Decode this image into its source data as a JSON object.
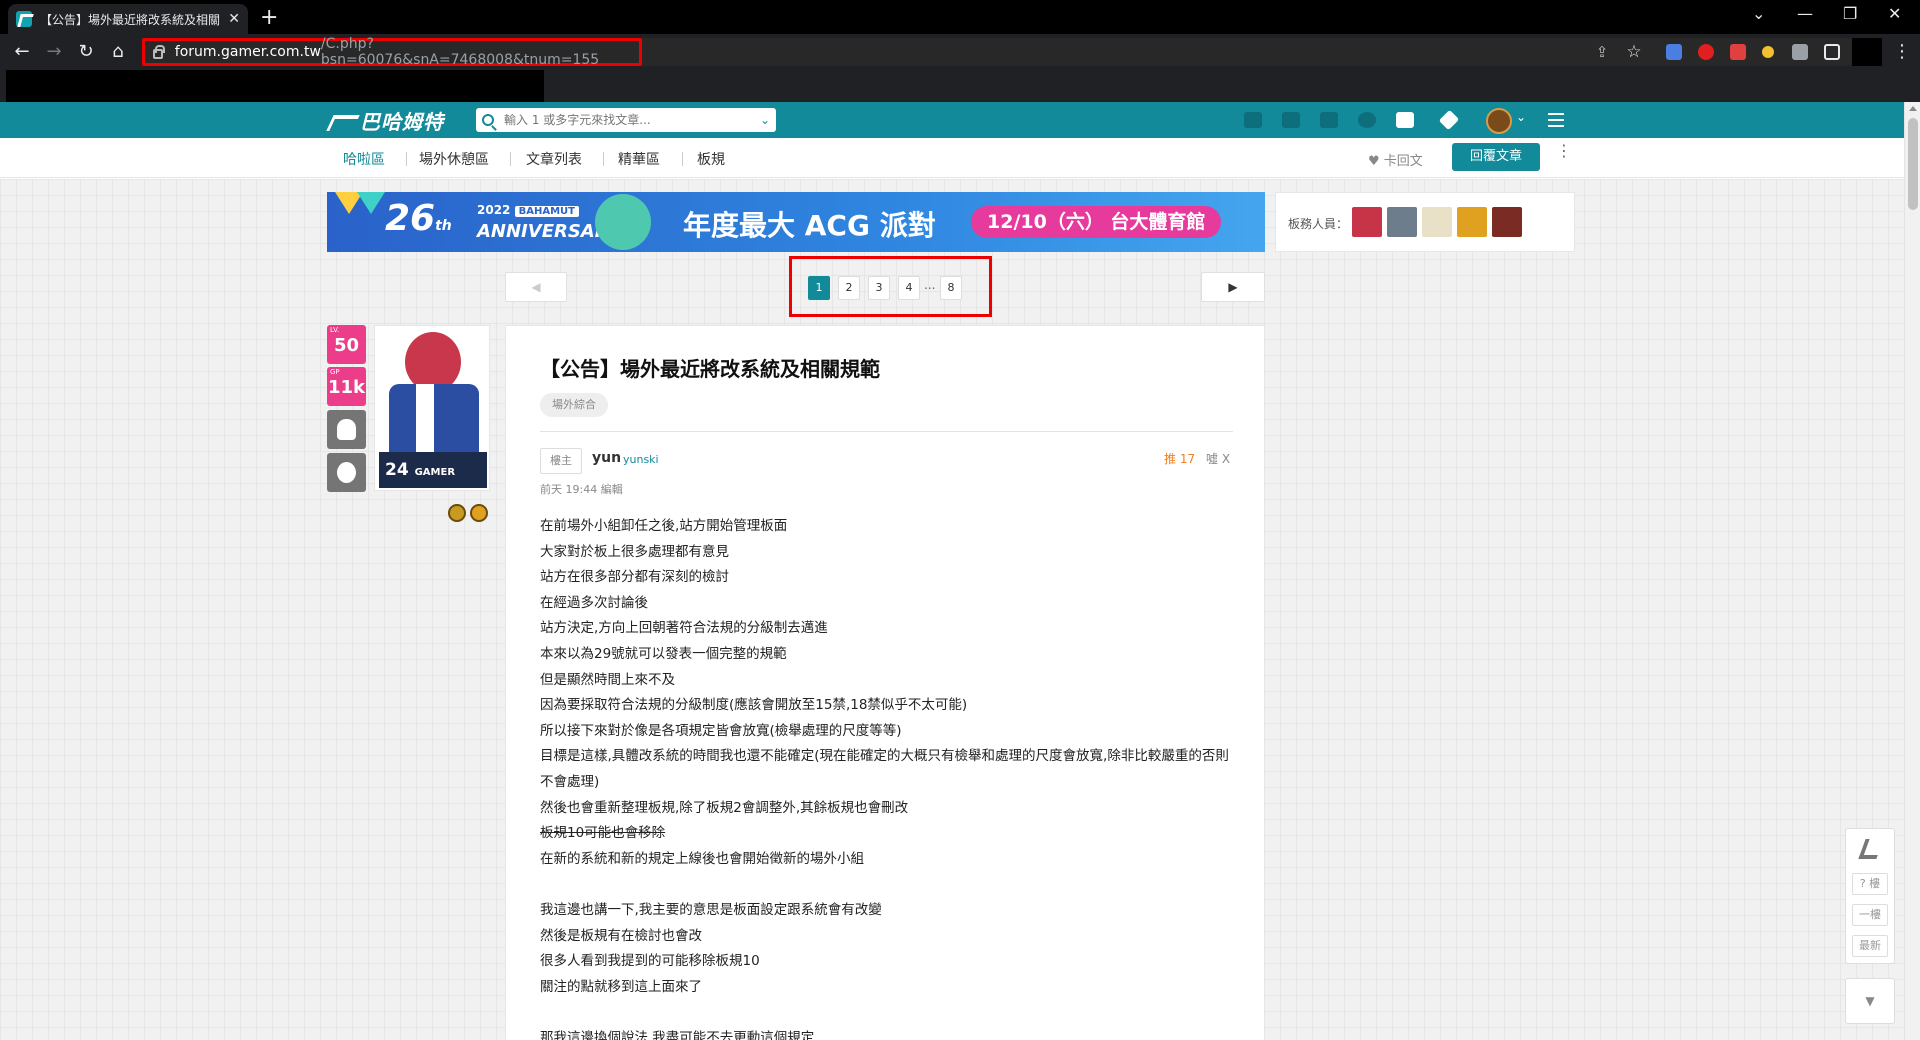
{
  "browser": {
    "tab_title": "【公告】場外最近將改系統及相關",
    "tab_close": "✕",
    "new_tab": "+",
    "url_host": "forum.gamer.com.tw",
    "url_path": "/C.php?bsn=60076&snA=7468008&tnum=155",
    "win_min": "⌄",
    "win_minimize": "—",
    "win_restore": "❐",
    "win_close": "✕",
    "back": "←",
    "forward": "→",
    "reload": "↻",
    "home": "⌂",
    "share": "⇪",
    "star": "☆",
    "menu": "⋮"
  },
  "site": {
    "logo": "巴哈姆特",
    "search_placeholder": "輸入 1 或多字元來找文章...",
    "search_chevron": "⌄",
    "avatar_chevron": "⌄",
    "nav": [
      "哈啦區",
      "場外休憩區",
      "文章列表",
      "精華區",
      "板規"
    ],
    "like_label": "♥ 卡回文",
    "reply_label": "回覆文章",
    "more": "⋮"
  },
  "banner": {
    "year": "26",
    "year_suffix": "th",
    "baha": "BAHAMUT",
    "anniv_year": "2022",
    "anniversary": "ANNIVERSARY",
    "headline": "年度最大 ACG 派對",
    "date": "12/10（六） 台大體育館"
  },
  "moderators": {
    "label": "板務人員：",
    "colors": [
      "#c73447",
      "#6d7d8c",
      "#e9e0c8",
      "#e0a020",
      "#7a2b24"
    ]
  },
  "pager": {
    "prev": "◀",
    "next": "▶",
    "pages": [
      "1",
      "2",
      "3",
      "4",
      "8"
    ],
    "ellipsis": "...",
    "current": "1"
  },
  "author": {
    "lv_key": "LV.",
    "lv": "50",
    "gp_key": "GP",
    "gp": "11k",
    "card_title": "24",
    "card_sub": "GAMER PARTY"
  },
  "post": {
    "title": "【公告】場外最近將改系統及相關規範",
    "tag": "場外綜合",
    "floor": "樓主",
    "author_name": "yun",
    "author_id": "yunski",
    "push": "推 17",
    "boo": "噓 X",
    "edit_time": "前天 19:44 編輯",
    "lines": [
      "在前場外小組卸任之後,站方開始管理板面",
      "大家對於板上很多處理都有意見",
      "站方在很多部分都有深刻的檢討",
      "在經過多次討論後",
      "站方決定,方向上回朝著符合法規的分級制去邁進",
      "本來以為29號就可以發表一個完整的規範",
      "但是顯然時間上來不及",
      "因為要採取符合法規的分級制度(應該會開放至15禁,18禁似乎不太可能)",
      "所以接下來對於像是各項規定皆會放寬(檢舉處理的尺度等等)",
      "目標是這樣,具體改系統的時間我也還不能確定(現在能確定的大概只有檢舉和處理的尺度會放寬,除非比較嚴重的否則不會處理)",
      "然後也會重新整理板規,除了板規2會調整外,其餘板規也會刪改",
      "板規10可能也會移除",
      "在新的系統和新的規定上線後也會開始徵新的場外小組",
      "",
      "我這邊也講一下,我主要的意思是板面設定跟系統會有改變",
      "然後是板規有在檢討也會改",
      "很多人看到我提到的可能移除板規10",
      "關注的點就移到這上面來了",
      "",
      "那我這邊換個說法,我盡可能不去更動這個規定"
    ]
  },
  "tools": {
    "q_floor": "? 樓",
    "floor_one": "一樓",
    "latest": "最新",
    "down": "▼"
  }
}
